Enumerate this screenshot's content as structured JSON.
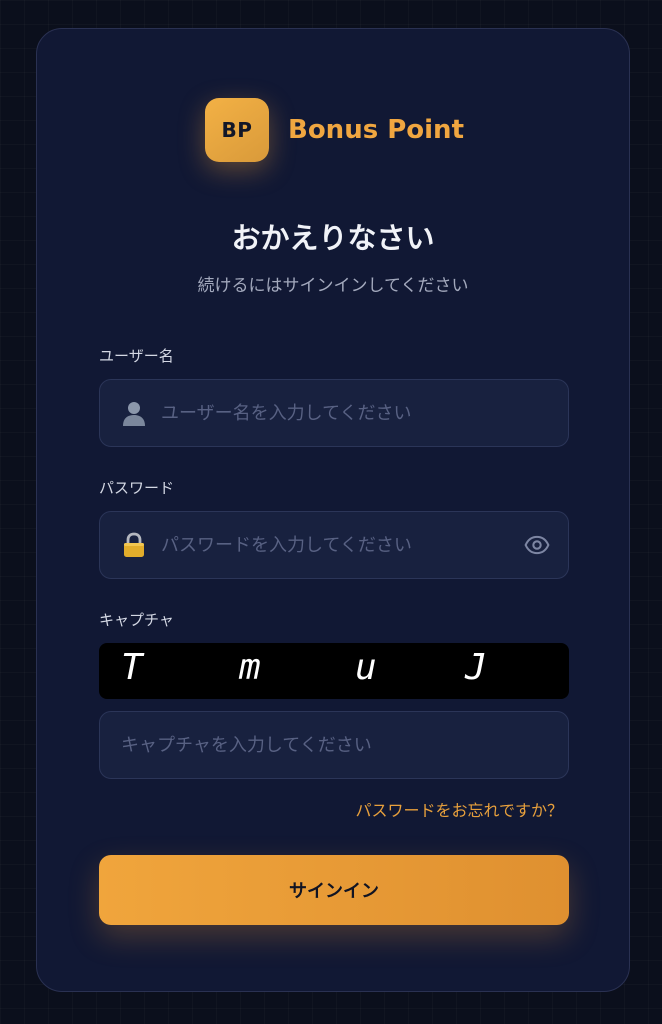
{
  "brand": {
    "logo_text": "BP",
    "name": "Bonus Point",
    "accent_color": "#f0a640"
  },
  "heading": {
    "title": "おかえりなさい",
    "subtitle": "続けるにはサインインしてください"
  },
  "username": {
    "label": "ユーザー名",
    "placeholder": "ユーザー名を入力してください",
    "value": "",
    "icon": "user-icon"
  },
  "password": {
    "label": "パスワード",
    "placeholder": "パスワードを入力してください",
    "value": "",
    "icon": "lock-icon",
    "toggle_icon": "eye-icon"
  },
  "captcha": {
    "label": "キャプチャ",
    "characters": [
      "T",
      "m",
      "u",
      "J"
    ],
    "placeholder": "キャプチャを入力してください",
    "value": ""
  },
  "forgot_password_link": "パスワードをお忘れですか？",
  "sign_in_button": "サインイン"
}
